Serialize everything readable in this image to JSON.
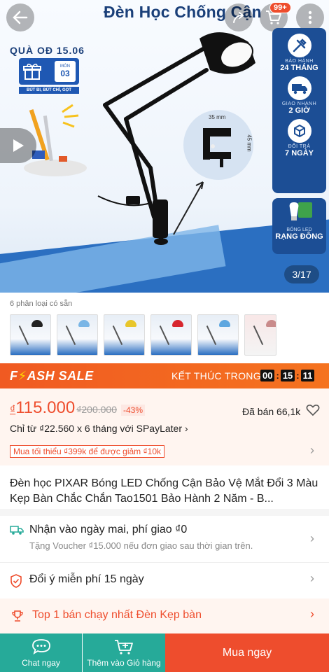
{
  "hero": {
    "title": "Đèn Học Chống Cận",
    "cart_badge": "99+",
    "gift_title": "QUÀ OĐ 15.06",
    "gift_count_label": "MÓN",
    "gift_count": "03",
    "gift_note": "BÚT BI, BÚT CHÌ, GỌT",
    "clamp_width": "35 mm",
    "clamp_height": "45 mm",
    "benefits": [
      {
        "icon": "tools-icon",
        "line1": "BẢO HÀNH",
        "line2": "24 THÁNG"
      },
      {
        "icon": "truck-icon",
        "line1": "GIAO NHANH",
        "line2": "2 GIỜ"
      },
      {
        "icon": "box-return-icon",
        "line1": "ĐỔI TRẢ",
        "line2": "7 NGÀY"
      }
    ],
    "led_line1": "BÓNG LED",
    "led_line2": "RẠNG ĐÔNG",
    "counter": "3/17"
  },
  "variants": {
    "label": "6 phân loại có sẵn",
    "colors": [
      "#222222",
      "#7ab6e6",
      "#e8c62b",
      "#d7262e",
      "#5ea7e0",
      "#c98b8b"
    ]
  },
  "flash_sale": {
    "title_prefix": "F",
    "title_rest": "ASH SALE",
    "ends_label": "KẾT THÚC TRONG",
    "hh": "00",
    "mm": "15",
    "ss": "11"
  },
  "price": {
    "currency": "₫",
    "current": "115.000",
    "original": "₫200.000",
    "discount": "-43%",
    "sold": "Đã bán 66,1k",
    "installment": "Chỉ từ ₫22.560 x 6 tháng với SPayLater",
    "voucher": "Mua tối thiểu ₫399k để được giảm ₫10k"
  },
  "product_name": "Đèn học PIXAR Bóng LED Chống Cận Bảo Vệ Mắt Đổi 3 Màu Kẹp Bàn Chắc Chắn Tao1501 Bảo Hành 2 Năm - B...",
  "shipping": {
    "title": "Nhận vào ngày mai, phí giao ₫0",
    "sub": "Tặng Voucher ₫15.000 nếu đơn giao sau thời gian trên."
  },
  "return_policy": "Đổi ý miễn phí 15 ngày",
  "top_seller": "Top 1 bán chạy nhất Đèn Kẹp bàn",
  "bottom_bar": {
    "chat": "Chat ngay",
    "add_cart": "Thêm vào Giỏ hàng",
    "buy": "Mua ngay"
  },
  "colors": {
    "primary": "#ee4d2d",
    "teal": "#26aa99",
    "navy": "#1c4e95"
  }
}
